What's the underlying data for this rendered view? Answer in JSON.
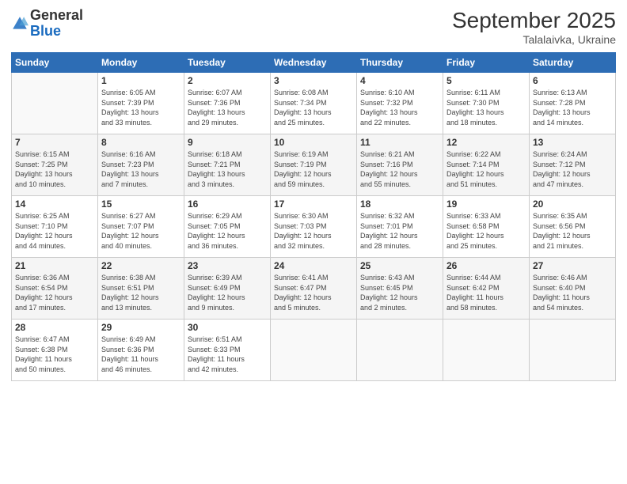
{
  "logo": {
    "general": "General",
    "blue": "Blue"
  },
  "title": "September 2025",
  "location": "Talalaivka, Ukraine",
  "days_of_week": [
    "Sunday",
    "Monday",
    "Tuesday",
    "Wednesday",
    "Thursday",
    "Friday",
    "Saturday"
  ],
  "weeks": [
    [
      {
        "day": "",
        "info": ""
      },
      {
        "day": "1",
        "info": "Sunrise: 6:05 AM\nSunset: 7:39 PM\nDaylight: 13 hours\nand 33 minutes."
      },
      {
        "day": "2",
        "info": "Sunrise: 6:07 AM\nSunset: 7:36 PM\nDaylight: 13 hours\nand 29 minutes."
      },
      {
        "day": "3",
        "info": "Sunrise: 6:08 AM\nSunset: 7:34 PM\nDaylight: 13 hours\nand 25 minutes."
      },
      {
        "day": "4",
        "info": "Sunrise: 6:10 AM\nSunset: 7:32 PM\nDaylight: 13 hours\nand 22 minutes."
      },
      {
        "day": "5",
        "info": "Sunrise: 6:11 AM\nSunset: 7:30 PM\nDaylight: 13 hours\nand 18 minutes."
      },
      {
        "day": "6",
        "info": "Sunrise: 6:13 AM\nSunset: 7:28 PM\nDaylight: 13 hours\nand 14 minutes."
      }
    ],
    [
      {
        "day": "7",
        "info": "Sunrise: 6:15 AM\nSunset: 7:25 PM\nDaylight: 13 hours\nand 10 minutes."
      },
      {
        "day": "8",
        "info": "Sunrise: 6:16 AM\nSunset: 7:23 PM\nDaylight: 13 hours\nand 7 minutes."
      },
      {
        "day": "9",
        "info": "Sunrise: 6:18 AM\nSunset: 7:21 PM\nDaylight: 13 hours\nand 3 minutes."
      },
      {
        "day": "10",
        "info": "Sunrise: 6:19 AM\nSunset: 7:19 PM\nDaylight: 12 hours\nand 59 minutes."
      },
      {
        "day": "11",
        "info": "Sunrise: 6:21 AM\nSunset: 7:16 PM\nDaylight: 12 hours\nand 55 minutes."
      },
      {
        "day": "12",
        "info": "Sunrise: 6:22 AM\nSunset: 7:14 PM\nDaylight: 12 hours\nand 51 minutes."
      },
      {
        "day": "13",
        "info": "Sunrise: 6:24 AM\nSunset: 7:12 PM\nDaylight: 12 hours\nand 47 minutes."
      }
    ],
    [
      {
        "day": "14",
        "info": "Sunrise: 6:25 AM\nSunset: 7:10 PM\nDaylight: 12 hours\nand 44 minutes."
      },
      {
        "day": "15",
        "info": "Sunrise: 6:27 AM\nSunset: 7:07 PM\nDaylight: 12 hours\nand 40 minutes."
      },
      {
        "day": "16",
        "info": "Sunrise: 6:29 AM\nSunset: 7:05 PM\nDaylight: 12 hours\nand 36 minutes."
      },
      {
        "day": "17",
        "info": "Sunrise: 6:30 AM\nSunset: 7:03 PM\nDaylight: 12 hours\nand 32 minutes."
      },
      {
        "day": "18",
        "info": "Sunrise: 6:32 AM\nSunset: 7:01 PM\nDaylight: 12 hours\nand 28 minutes."
      },
      {
        "day": "19",
        "info": "Sunrise: 6:33 AM\nSunset: 6:58 PM\nDaylight: 12 hours\nand 25 minutes."
      },
      {
        "day": "20",
        "info": "Sunrise: 6:35 AM\nSunset: 6:56 PM\nDaylight: 12 hours\nand 21 minutes."
      }
    ],
    [
      {
        "day": "21",
        "info": "Sunrise: 6:36 AM\nSunset: 6:54 PM\nDaylight: 12 hours\nand 17 minutes."
      },
      {
        "day": "22",
        "info": "Sunrise: 6:38 AM\nSunset: 6:51 PM\nDaylight: 12 hours\nand 13 minutes."
      },
      {
        "day": "23",
        "info": "Sunrise: 6:39 AM\nSunset: 6:49 PM\nDaylight: 12 hours\nand 9 minutes."
      },
      {
        "day": "24",
        "info": "Sunrise: 6:41 AM\nSunset: 6:47 PM\nDaylight: 12 hours\nand 5 minutes."
      },
      {
        "day": "25",
        "info": "Sunrise: 6:43 AM\nSunset: 6:45 PM\nDaylight: 12 hours\nand 2 minutes."
      },
      {
        "day": "26",
        "info": "Sunrise: 6:44 AM\nSunset: 6:42 PM\nDaylight: 11 hours\nand 58 minutes."
      },
      {
        "day": "27",
        "info": "Sunrise: 6:46 AM\nSunset: 6:40 PM\nDaylight: 11 hours\nand 54 minutes."
      }
    ],
    [
      {
        "day": "28",
        "info": "Sunrise: 6:47 AM\nSunset: 6:38 PM\nDaylight: 11 hours\nand 50 minutes."
      },
      {
        "day": "29",
        "info": "Sunrise: 6:49 AM\nSunset: 6:36 PM\nDaylight: 11 hours\nand 46 minutes."
      },
      {
        "day": "30",
        "info": "Sunrise: 6:51 AM\nSunset: 6:33 PM\nDaylight: 11 hours\nand 42 minutes."
      },
      {
        "day": "",
        "info": ""
      },
      {
        "day": "",
        "info": ""
      },
      {
        "day": "",
        "info": ""
      },
      {
        "day": "",
        "info": ""
      }
    ]
  ]
}
